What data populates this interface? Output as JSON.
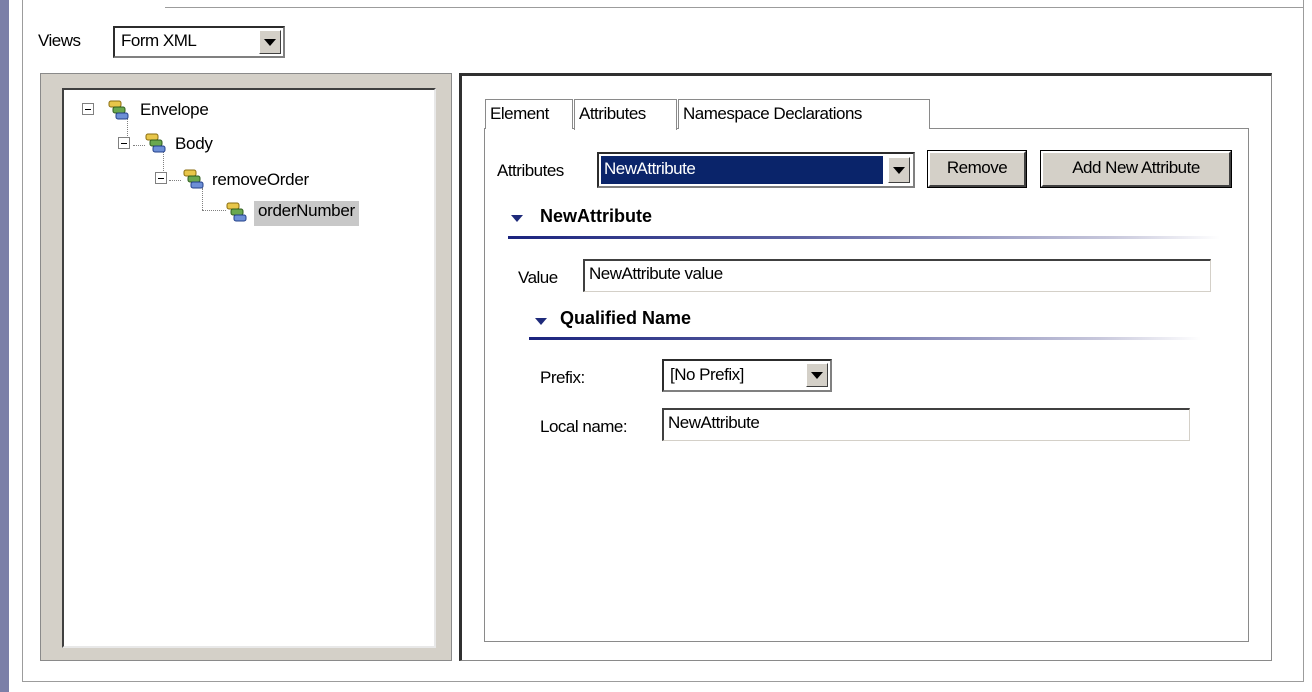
{
  "views": {
    "label": "Views",
    "selected": "Form XML"
  },
  "tree": {
    "nodes": [
      {
        "label": "Envelope"
      },
      {
        "label": "Body"
      },
      {
        "label": "removeOrder"
      },
      {
        "label": "orderNumber"
      }
    ]
  },
  "tabs": [
    {
      "label": "Element"
    },
    {
      "label": "Attributes"
    },
    {
      "label": "Namespace Declarations"
    }
  ],
  "attributes": {
    "label": "Attributes",
    "selected": "NewAttribute",
    "remove_label": "Remove",
    "add_label": "Add New Attribute"
  },
  "section": {
    "title": "NewAttribute",
    "value_label": "Value",
    "value": "NewAttribute value"
  },
  "qualified_name": {
    "title": "Qualified Name",
    "prefix_label": "Prefix:",
    "prefix_value": "[No Prefix]",
    "local_name_label": "Local name:",
    "local_name_value": "NewAttribute"
  },
  "colors": {
    "accent": "#1a237e",
    "selection": "#0a246a",
    "button_face": "#d4d0c8"
  }
}
